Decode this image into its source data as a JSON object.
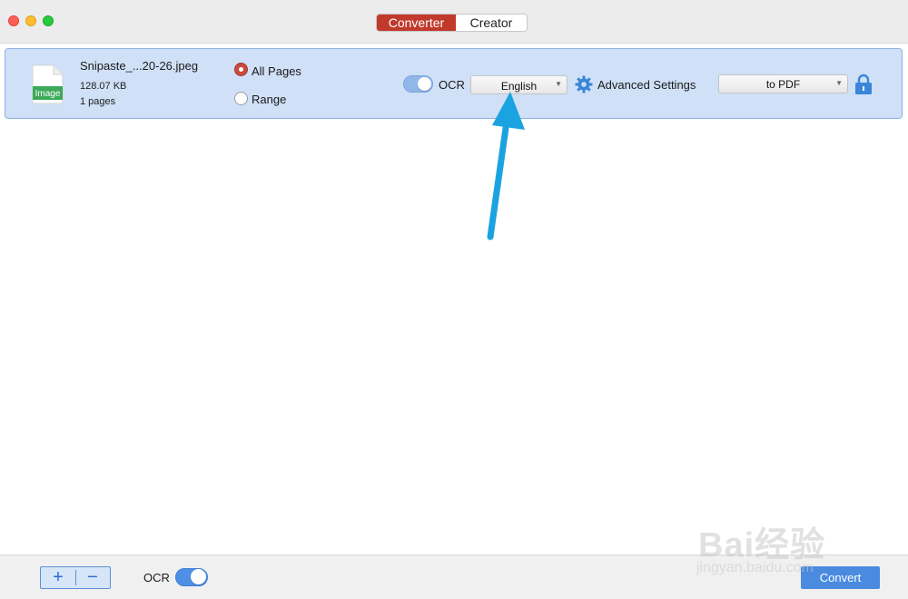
{
  "titlebar": {
    "tabs": [
      {
        "label": "Converter",
        "active": true
      },
      {
        "label": "Creator",
        "active": false
      }
    ]
  },
  "file": {
    "icon_label": "Image",
    "name": "Snipaste_...20-26.jpeg",
    "size": "128.07 KB",
    "pages": "1 pages",
    "page_options": {
      "all_label": "All Pages",
      "range_label": "Range",
      "selected": "All Pages"
    },
    "ocr_label": "OCR",
    "ocr_enabled": true,
    "language": "English",
    "advanced_label": "Advanced Settings",
    "format": "to PDF"
  },
  "bottom": {
    "add_label": "+",
    "remove_label": "−",
    "ocr_label": "OCR",
    "ocr_enabled": true,
    "convert_label": "Convert"
  },
  "watermark": {
    "main": "Bai经验",
    "sub": "jingyan.baidu.com"
  },
  "colors": {
    "accent_red": "#c0392b",
    "row_highlight": "#cfe0f7",
    "accent_blue": "#4a8be0",
    "arrow": "#1aa3e0"
  }
}
